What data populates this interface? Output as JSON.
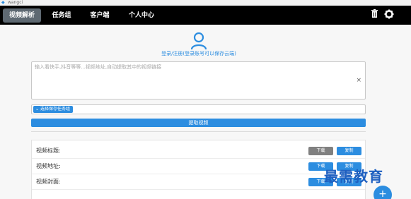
{
  "window": {
    "title": "wangci"
  },
  "nav": {
    "tabs": [
      {
        "label": "视频解析",
        "active": true
      },
      {
        "label": "任务组",
        "active": false
      },
      {
        "label": "客户端",
        "active": false
      },
      {
        "label": "个人中心",
        "active": false
      }
    ],
    "icons": [
      "trash-icon",
      "gear-icon"
    ]
  },
  "account": {
    "login_text": "登录/注册(登录账号可以保存云端)"
  },
  "input": {
    "placeholder": "输入看快手,抖音等等...视频地址,自动提取其中的视频链接",
    "clear_glyph": "×"
  },
  "task_group": {
    "label": "选择保存任务组"
  },
  "extract_button": "提取视频",
  "results": {
    "rows": [
      {
        "label": "视频标题:",
        "download": "下载",
        "copy": "复制",
        "download_enabled": false
      },
      {
        "label": "视频地址:",
        "download": "下载",
        "copy": "复制",
        "download_enabled": true
      },
      {
        "label": "视频封面:",
        "download": "下载",
        "copy": "复制",
        "download_enabled": true
      }
    ]
  },
  "watermark": "最需教育",
  "fab": "+",
  "colors": {
    "accent": "#2c8de0",
    "nav_bg": "#000000",
    "active_tab": "#5e6972",
    "disabled_btn": "#808080"
  }
}
